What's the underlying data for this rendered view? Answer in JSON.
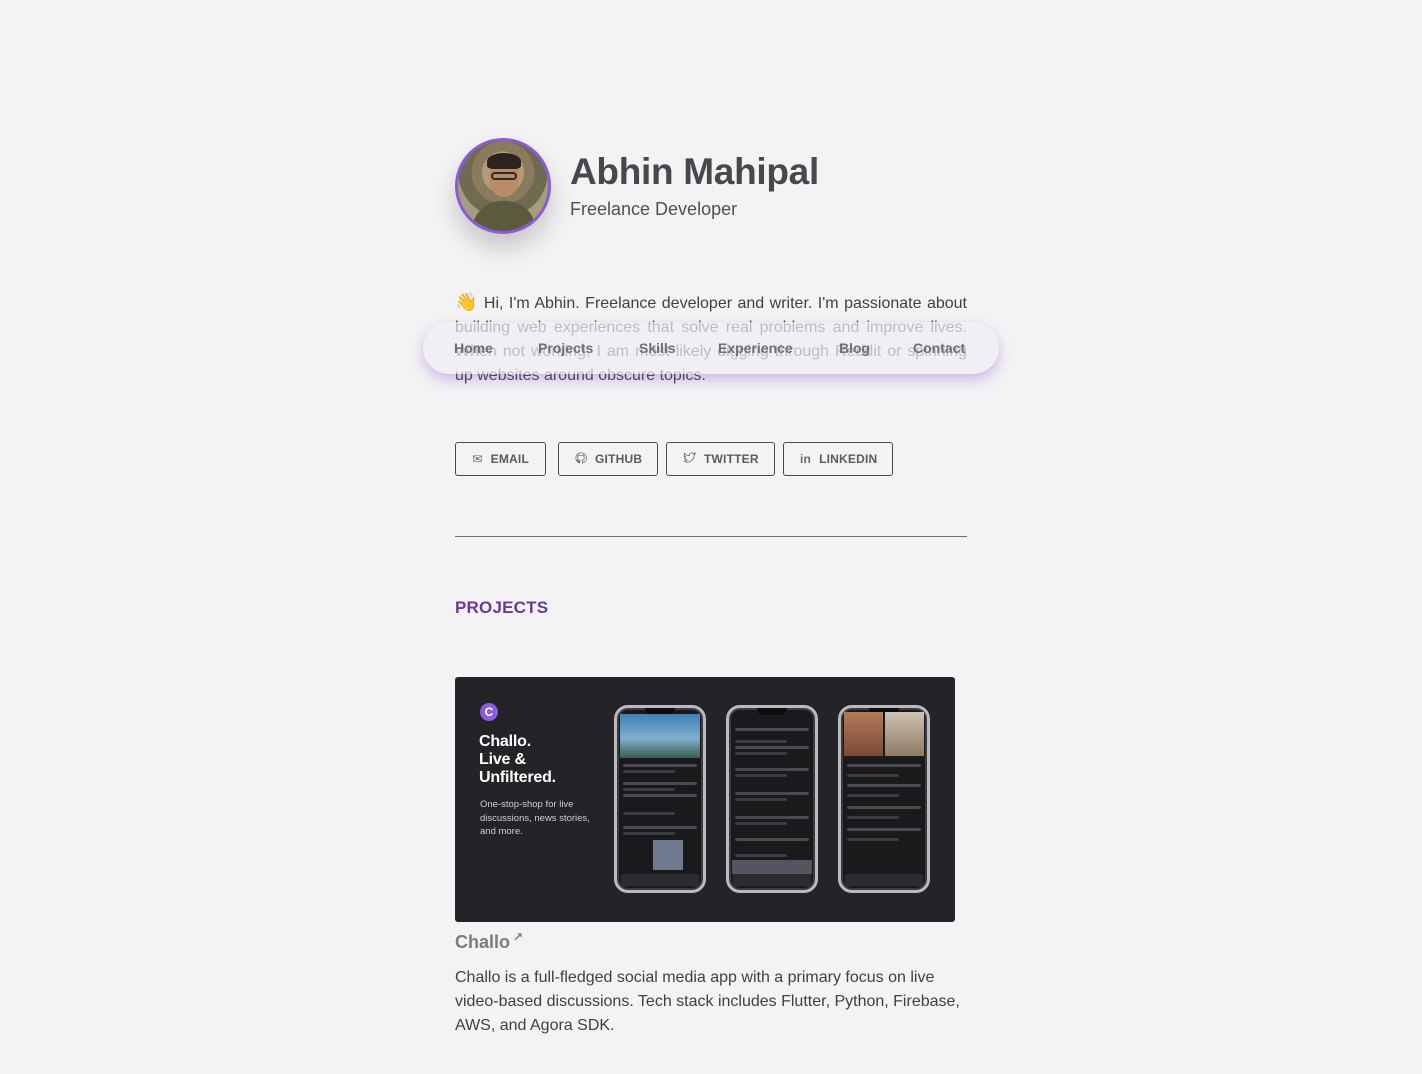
{
  "profile": {
    "name": "Abhin Mahipal",
    "role": "Freelance Developer"
  },
  "intro": {
    "wave": "👋",
    "text": "Hi, I'm Abhin. Freelance developer and writer. I'm passionate about building web experiences that solve real problems and improve lives. When not working, I am most likely digging through Reddit or spinning up websites around obscure topics."
  },
  "nav": {
    "items": [
      "Home",
      "Projects",
      "Skills",
      "Experience",
      "Blog",
      "Contact"
    ]
  },
  "socials": [
    {
      "label": "EMAIL",
      "icon": "mail-icon"
    },
    {
      "label": "GITHUB",
      "icon": "github-icon"
    },
    {
      "label": "TWITTER",
      "icon": "twitter-icon"
    },
    {
      "label": "LINKEDIN",
      "icon": "linkedin-icon"
    }
  ],
  "projects_section": {
    "title": "PROJECTS"
  },
  "project": {
    "logo_letter": "C",
    "headline_lines": [
      "Challo.",
      "Live &",
      "Unfiltered."
    ],
    "tagline": "One-stop-shop for live discussions, news stories, and more.",
    "name": "Challo",
    "link_icon": "external-link-icon",
    "description": "Challo is a full-fledged social media app with a primary focus on live video-based discussions. Tech stack includes Flutter, Python, Firebase, AWS, and Agora SDK."
  },
  "colors": {
    "accent": "#8b5bd3",
    "section_title": "#6a3a96",
    "background": "#f3f2f4"
  }
}
